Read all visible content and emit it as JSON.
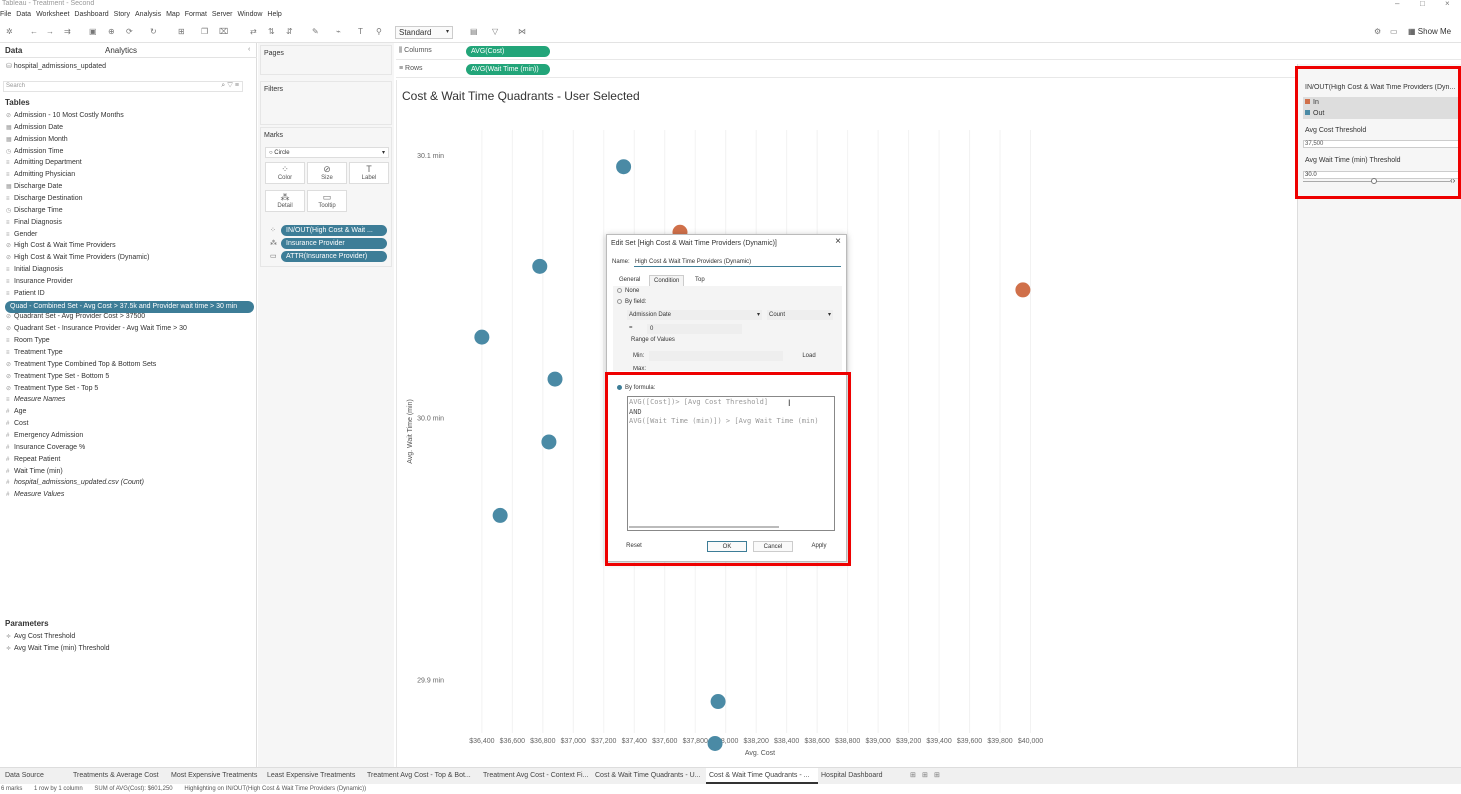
{
  "app": {
    "window_title": "Tableau - Treatment - Second"
  },
  "menu": [
    "File",
    "Data",
    "Worksheet",
    "Dashboard",
    "Story",
    "Analysis",
    "Map",
    "Format",
    "Server",
    "Window",
    "Help"
  ],
  "toolbar": {
    "mark_type": "Standard",
    "show_me": "Show Me"
  },
  "left_pane": {
    "tabs": {
      "data": "Data",
      "analytics": "Analytics"
    },
    "datasource": "hospital_admissions_updated",
    "search_placeholder": "Search",
    "tables_header": "Tables",
    "fields": [
      {
        "name": "Admission - 10 Most Costly Months",
        "icon": "set-icon",
        "italic": false
      },
      {
        "name": "Admission Date",
        "icon": "date-icon",
        "italic": false
      },
      {
        "name": "Admission Month",
        "icon": "date-icon",
        "italic": false
      },
      {
        "name": "Admission Time",
        "icon": "datetime-icon",
        "italic": false
      },
      {
        "name": "Admitting Department",
        "icon": "abc-icon",
        "italic": false
      },
      {
        "name": "Admitting Physician",
        "icon": "abc-icon",
        "italic": false
      },
      {
        "name": "Discharge Date",
        "icon": "date-icon",
        "italic": false
      },
      {
        "name": "Discharge Destination",
        "icon": "abc-icon",
        "italic": false
      },
      {
        "name": "Discharge Time",
        "icon": "datetime-icon",
        "italic": false
      },
      {
        "name": "Final Diagnosis",
        "icon": "abc-icon",
        "italic": false
      },
      {
        "name": "Gender",
        "icon": "abc-icon",
        "italic": false
      },
      {
        "name": "High Cost & Wait Time Providers",
        "icon": "set-icon",
        "italic": false
      },
      {
        "name": "High Cost & Wait Time Providers (Dynamic)",
        "icon": "set-icon",
        "italic": false
      },
      {
        "name": "Initial Diagnosis",
        "icon": "abc-icon",
        "italic": false
      },
      {
        "name": "Insurance Provider",
        "icon": "abc-icon",
        "italic": false
      },
      {
        "name": "Patient ID",
        "icon": "abc-icon",
        "italic": false
      },
      {
        "name": "Quad - Combined Set - Avg Cost > 37.5k and Provider wait time > 30 min",
        "icon": "set-icon",
        "italic": false
      },
      {
        "name": "Quadrant Set - Avg Provider Cost > 37500",
        "icon": "set-icon",
        "italic": false
      },
      {
        "name": "Quadrant Set - Insurance Provider - Avg Wait Time > 30",
        "icon": "set-icon",
        "italic": false
      },
      {
        "name": "Room Type",
        "icon": "abc-icon",
        "italic": false
      },
      {
        "name": "Treatment Type",
        "icon": "abc-icon",
        "italic": false
      },
      {
        "name": "Treatment Type Combined Top & Bottom Sets",
        "icon": "set-icon",
        "italic": false
      },
      {
        "name": "Treatment Type Set - Bottom 5",
        "icon": "set-icon",
        "italic": false
      },
      {
        "name": "Treatment Type Set - Top 5",
        "icon": "set-icon",
        "italic": false
      },
      {
        "name": "Measure Names",
        "icon": "abc-icon",
        "italic": true
      },
      {
        "name": "Age",
        "icon": "number-icon",
        "italic": false
      },
      {
        "name": "Cost",
        "icon": "number-icon",
        "italic": false
      },
      {
        "name": "Emergency Admission",
        "icon": "number-icon",
        "italic": false
      },
      {
        "name": "Insurance Coverage %",
        "icon": "number-icon",
        "italic": false
      },
      {
        "name": "Repeat Patient",
        "icon": "number-icon",
        "italic": false
      },
      {
        "name": "Wait Time (min)",
        "icon": "number-icon",
        "italic": false
      },
      {
        "name": "hospital_admissions_updated.csv (Count)",
        "icon": "number-icon",
        "italic": true
      },
      {
        "name": "Measure Values",
        "icon": "number-icon",
        "italic": true
      }
    ],
    "parameters_header": "Parameters",
    "parameters": [
      "Avg Cost Threshold",
      "Avg Wait Time (min) Threshold"
    ]
  },
  "cards": {
    "pages": "Pages",
    "filters": "Filters",
    "marks": "Marks",
    "mark_type": "Circle",
    "buttons": [
      "Color",
      "Size",
      "Label",
      "Detail",
      "Tooltip"
    ],
    "pills": [
      "IN/OUT(High Cost & Wait ...",
      "Insurance Provider",
      "ATTR(Insurance Provider)"
    ]
  },
  "shelves": {
    "columns_label": "Columns",
    "columns_pill": "AVG(Cost)",
    "rows_label": "Rows",
    "rows_pill": "AVG(Wait Time (min))"
  },
  "viz": {
    "title": "Cost & Wait Time Quadrants - User Selected"
  },
  "chart_data": {
    "type": "scatter",
    "xlabel": "Avg. Cost",
    "ylabel": "Avg. Wait Time (min)",
    "xlim": [
      36250,
      40200
    ],
    "ylim": [
      29.88,
      30.11
    ],
    "x_ticks": [
      "$36,400",
      "$36,600",
      "$36,800",
      "$37,000",
      "$37,200",
      "$37,400",
      "$37,600",
      "$37,800",
      "$38,000",
      "$38,200",
      "$38,400",
      "$38,600",
      "$38,800",
      "$39,000",
      "$39,200",
      "$39,400",
      "$39,600",
      "$39,800",
      "$40,000"
    ],
    "x_tick_values": [
      36400,
      36600,
      36800,
      37000,
      37200,
      37400,
      37600,
      37800,
      38000,
      38200,
      38400,
      38600,
      38800,
      39000,
      39200,
      39400,
      39600,
      39800,
      40000
    ],
    "y_ticks": [
      "30.1 min",
      "30.0 min",
      "29.9 min"
    ],
    "y_tick_values": [
      30.1,
      30.0,
      29.9
    ],
    "colors": {
      "In": "#d0704a",
      "Out": "#4a8aa5"
    },
    "points": [
      {
        "x": 37330,
        "y": 30.096,
        "set": "Out"
      },
      {
        "x": 37700,
        "y": 30.071,
        "set": "In"
      },
      {
        "x": 38000,
        "y": 30.066,
        "set": "In"
      },
      {
        "x": 36780,
        "y": 30.058,
        "set": "Out"
      },
      {
        "x": 39950,
        "y": 30.049,
        "set": "In"
      },
      {
        "x": 36400,
        "y": 30.031,
        "set": "Out"
      },
      {
        "x": 36880,
        "y": 30.015,
        "set": "Out"
      },
      {
        "x": 36840,
        "y": 29.991,
        "set": "Out"
      },
      {
        "x": 36520,
        "y": 29.963,
        "set": "Out"
      },
      {
        "x": 37950,
        "y": 29.892,
        "set": "Out"
      },
      {
        "x": 37930,
        "y": 29.876,
        "set": "Out"
      }
    ]
  },
  "legend": {
    "title": "IN/OUT(High Cost & Wait Time Providers (Dyn...",
    "items": [
      "In",
      "Out"
    ]
  },
  "param_controls": [
    {
      "label": "Avg Cost Threshold",
      "value": "37,500"
    },
    {
      "label": "Avg Wait Time (min) Threshold",
      "value": "30.0",
      "slider_fraction": 0.48
    }
  ],
  "dialog": {
    "title": "Edit Set [High Cost & Wait Time Providers (Dynamic)]",
    "name_label": "Name:",
    "name_value": "High Cost & Wait Time Providers (Dynamic)",
    "tabs": [
      "General",
      "Condition",
      "Top"
    ],
    "active_tab": "Condition",
    "radio_none": "None",
    "radio_by_field": "By field:",
    "field_select": "Admission Date",
    "agg_select": "Count",
    "operator": "=",
    "operand": "0",
    "range_label": "Range of Values",
    "min_label": "Min:",
    "max_label": "Max:",
    "load_button": "Load",
    "radio_by_formula": "By formula:",
    "formula_lines": [
      "AVG([Cost])> [Avg Cost Threshold]",
      "AND",
      "AVG([Wait Time (min)]) > [Avg Wait Time (min)"
    ],
    "buttons": {
      "reset": "Reset",
      "ok": "OK",
      "cancel": "Cancel",
      "apply": "Apply"
    }
  },
  "sheet_tabs": [
    "Data Source",
    "Treatments & Average Cost",
    "Most Expensive Treatments",
    "Least Expensive Treatments",
    "Treatment Avg Cost - Top & Bot...",
    "Treatment Avg Cost - Context Fi...",
    "Cost & Wait Time Quadrants - U...",
    "Cost & Wait Time Quadrants - ...",
    "Hospital Dashboard"
  ],
  "active_sheet": 7,
  "status": {
    "marks": "6 marks",
    "dims": "1 row by 1 column",
    "sum": "SUM of AVG(Cost): $601,250",
    "highlight": "Highlighting on IN/OUT(High Cost & Wait Time Providers (Dynamic))"
  }
}
